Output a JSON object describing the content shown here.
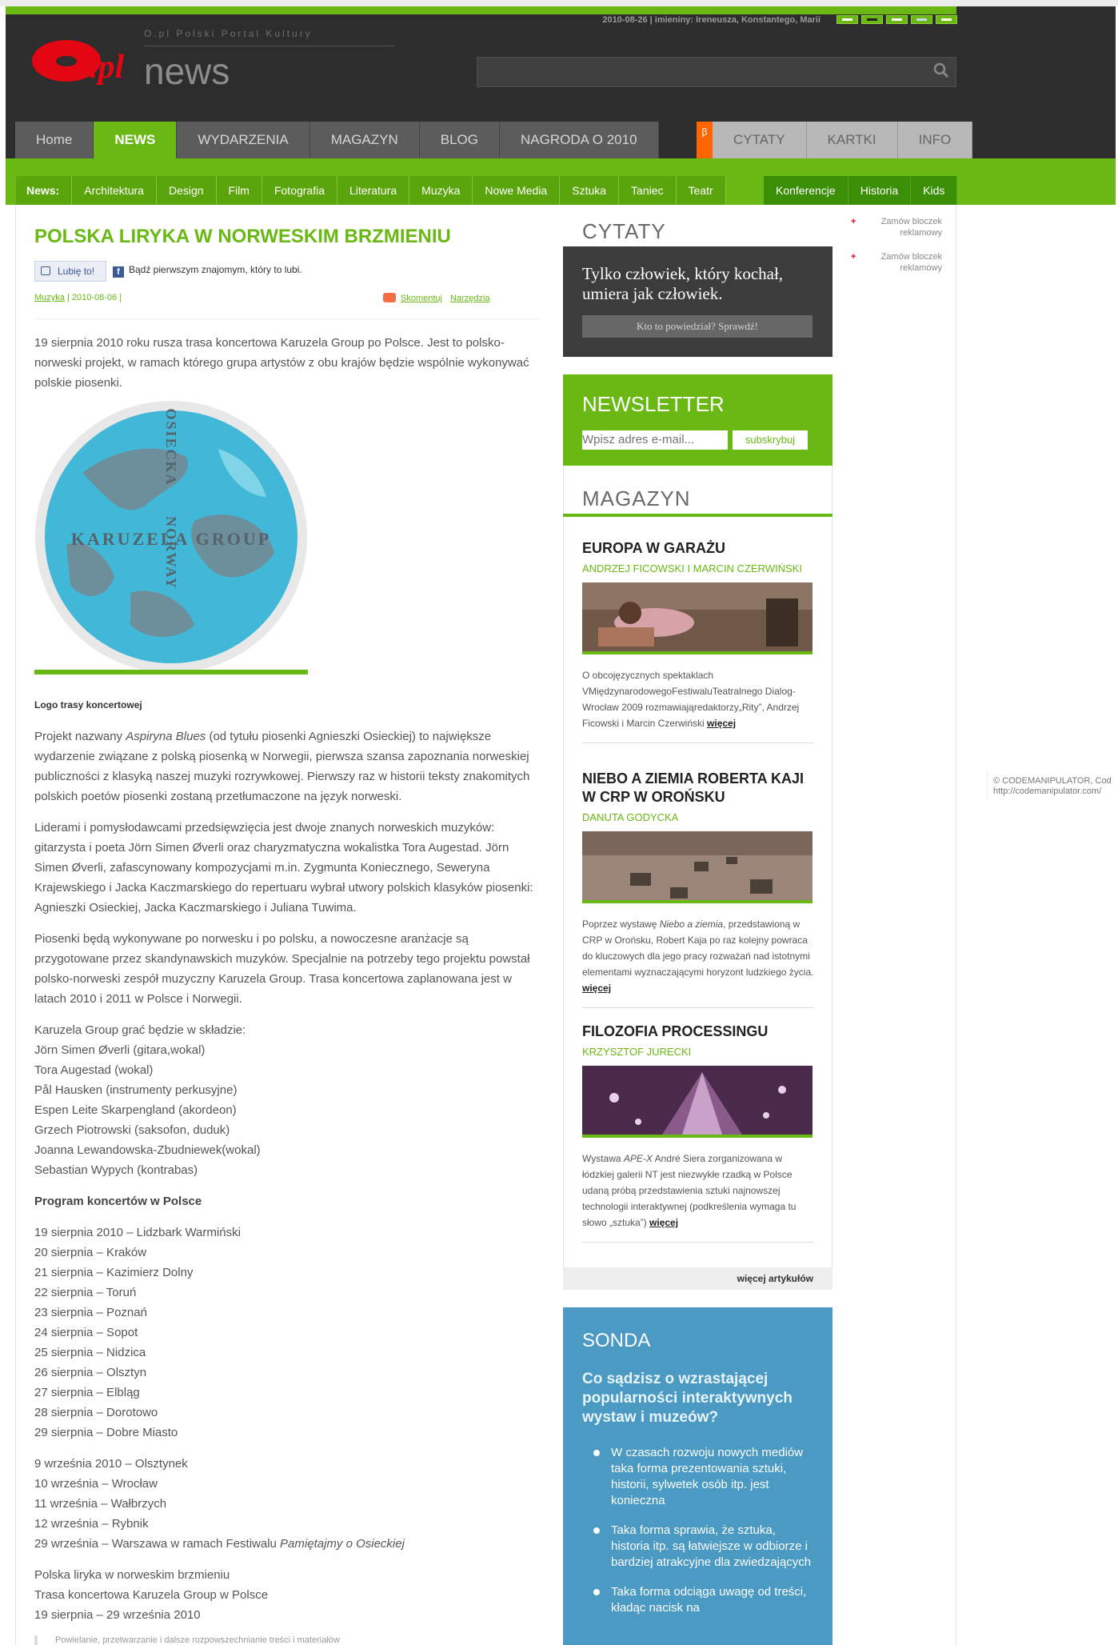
{
  "header": {
    "date_line": "2010-08-26 | imieniny: Ireneusza, Konstantego, Marii",
    "logo_subtitle": "O.pl Polski Portal Kultury",
    "logo_text": ".pl",
    "logo_section": "news",
    "search_placeholder": ""
  },
  "nav": {
    "items": [
      "Home",
      "NEWS",
      "WYDARZENIA",
      "MAGAZYN",
      "BLOG",
      "NAGRODA O 2010"
    ],
    "beta": "β",
    "right_items": [
      "CYTATY",
      "KARTKI",
      "INFO"
    ]
  },
  "subnav": {
    "label": "News:",
    "items": [
      "Architektura",
      "Design",
      "Film",
      "Fotografia",
      "Literatura",
      "Muzyka",
      "Nowe Media",
      "Sztuka",
      "Taniec",
      "Teatr"
    ],
    "right_items": [
      "Konferencje",
      "Historia",
      "Kids"
    ]
  },
  "article": {
    "title": "POLSKA LIRYKA W NORWESKIM BRZMIENIU",
    "like_label": "Lubię to!",
    "like_text": "Bądź pierwszym znajomym, który to lubi.",
    "category": "Muzyka",
    "date": " | 2010-08-06 |",
    "comment_label": "Skomentuj",
    "tools_label": "Narzędzia",
    "intro": "19 sierpnia 2010 roku rusza trasa koncertowa Karuzela Group po Polsce. Jest to polsko-norweski projekt, w ramach którego grupa artystów z obu krajów będzie wspólnie wykonywać polskie piosenki.",
    "image_text_h": "KARUZELA GROUP",
    "image_text_v1": "OSIECKA",
    "image_text_v2": "NORWAY",
    "caption": "Logo trasy koncertowej",
    "p1_a": "Projekt nazwany ",
    "p1_em": "Aspiryna Blues",
    "p1_b": " (od tytułu piosenki Agnieszki Osieckiej) to największe wydarzenie związane z polską piosenką w Norwegii, pierwsza szansa zapoznania norweskiej publiczności z klasyką naszej muzyki rozrywkowej. Pierwszy raz w historii teksty znakomitych polskich poetów piosenki zostaną przetłumaczone na język norweski.",
    "p2": "Liderami i pomysłodawcami przedsięwzięcia jest dwoje znanych norweskich muzyków: gitarzysta i poeta Jörn Simen Øverli oraz charyzmatyczna wokalistka Tora Augestad. Jörn Simen Øverli, zafascynowany kompozycjami m.in. Zygmunta Koniecznego, Seweryna Krajewskiego i Jacka Kaczmarskiego do repertuaru wybrał utwory polskich klasyków piosenki: Agnieszki Osieckiej, Jacka Kaczmarskiego i Juliana Tuwima.",
    "p3": "Piosenki będą wykonywane po norwesku i po polsku, a nowoczesne aranżacje są przygotowane przez skandynawskich muzyków. Specjalnie na potrzeby tego projektu powstał polsko-norweski zespół muzyczny Karuzela Group. Trasa koncertowa zaplanowana jest w latach 2010 i 2011 w Polsce i Norwegii.",
    "lineup_intro": "Karuzela Group grać będzie w składzie:",
    "lineup": [
      "Jörn Simen Øverli (gitara,wokal)",
      "Tora Augestad (wokal)",
      "Pål Hausken (instrumenty perkusyjne)",
      "Espen Leite Skarpengland (akordeon)",
      "Grzech Piotrowski (saksofon, duduk)",
      "Joanna Lewandowska-Zbudniewek(wokal)",
      "Sebastian Wypych (kontrabas)"
    ],
    "program_title": "Program koncertów w Polsce",
    "program_aug": [
      "19 sierpnia 2010 – Lidzbark Warmiński",
      "20 sierpnia – Kraków",
      "21 sierpnia – Kazimierz Dolny",
      "22 sierpnia – Toruń",
      "23 sierpnia – Poznań",
      "24 sierpnia – Sopot",
      "25 sierpnia – Nidzica",
      "26 sierpnia – Olsztyn",
      "27 sierpnia – Elbląg",
      "28 sierpnia – Dorotowo",
      "29 sierpnia – Dobre Miasto"
    ],
    "program_sep": [
      "9 września 2010 – Olsztynek",
      "10 września – Wrocław",
      "11 września – Wałbrzych",
      "12 września – Rybnik"
    ],
    "program_last_a": "29 września – Warszawa w ramach Festiwalu ",
    "program_last_em": "Pamiętajmy o Osieckiej",
    "summary": [
      "Polska liryka w norweskim brzmieniu",
      "Trasa koncertowa Karuzela Group w Polsce",
      "19 sierpnia – 29 września 2010"
    ],
    "footnote": "Powielanie, przetwarzanie i dalsze rozpowszechnianie treści i materiałów"
  },
  "sidebar": {
    "cytaty_title": "CYTATY",
    "quote": "Tylko człowiek, który kochał, umiera jak człowiek.",
    "quote_button": "Kto to powiedział? Sprawdź!",
    "newsletter_title": "NEWSLETTER",
    "newsletter_placeholder": "Wpisz adres e-mail...",
    "newsletter_button": "subskrybuj",
    "magazyn_title": "MAGAZYN",
    "articles": [
      {
        "title": "EUROPA W GARAŻU",
        "author": "ANDRZEJ FICOWSKI I MARCIN CZERWIŃSKI",
        "desc": "O obcojęzycznych spektaklach VMiędzynarodowegoFestiwaluTeatralnego Dialog-Wrocław 2009 rozmawiająredaktorzy„Rity”, Andrzej Ficowski i Marcin Czerwiński",
        "more": "więcej"
      },
      {
        "title": "NIEBO A ZIEMIA ROBERTA KAJI W CRP W OROŃSKU",
        "author": "DANUTA GODYCKA",
        "desc_a": "Poprzez wystawę ",
        "desc_em": "Niebo a ziemia",
        "desc_b": ", przedstawioną w CRP w Orońsku, Robert Kaja po raz kolejny powraca do kluczowych dla jego pracy rozważań nad istotnymi elementami wyznaczającymi horyzont ludzkiego życia.",
        "more": "więcej"
      },
      {
        "title": "FILOZOFIA PROCESSINGU",
        "author": "KRZYSZTOF JURECKI",
        "desc_a": "Wystawa ",
        "desc_em": "APE-X",
        "desc_b": " André Siera zorganizowana w łódzkiej galerii NT jest niezwykłe rzadką w Polsce udaną próbą przedstawienia sztuki najnowszej technologii interaktywnej (podkreślenia wymaga tu słowo „sztuka”)",
        "more": "więcej"
      }
    ],
    "more_articles": "więcej artykułów",
    "sonda_title": "SONDA",
    "sonda_question": "Co sądzisz o wzrastającej popularności interaktywnych wystaw i muzeów?",
    "sonda_answers": [
      "W czasach rozwoju nowych mediów taka forma prezentowania sztuki, historii, sylwetek osób itp. jest konieczna",
      "Taka forma sprawia, że sztuka, historia itp. są łatwiejsze w odbiorze i bardziej atrakcyjne dla zwiedzających",
      "Taka forma odciąga uwagę od treści, kładąc nacisk na"
    ]
  },
  "ads": [
    "Zamów bloczek reklamowy",
    "Zamów bloczek reklamowy"
  ],
  "ad_marker": "+",
  "copyright": [
    "© CODEMANIPULATOR, Cod",
    "http://codemanipulator.com/"
  ],
  "colors": {
    "green": "#6ab814",
    "dark": "#2d2d2d",
    "red": "#e30613",
    "blue": "#4a9ac4",
    "orange": "#ff6600"
  }
}
